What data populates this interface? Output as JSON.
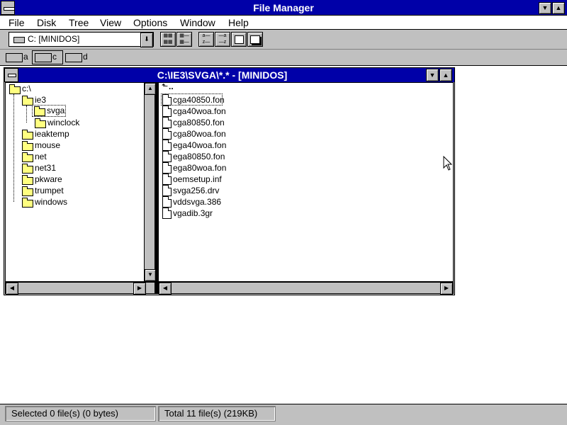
{
  "window": {
    "title": "File Manager"
  },
  "menu": [
    {
      "label": "File"
    },
    {
      "label": "Disk"
    },
    {
      "label": "Tree"
    },
    {
      "label": "View"
    },
    {
      "label": "Options"
    },
    {
      "label": "Window"
    },
    {
      "label": "Help"
    }
  ],
  "toolbar": {
    "drive_combo_value": "C: [MINIDOS]"
  },
  "drives": [
    {
      "label": "a"
    },
    {
      "label": "c"
    },
    {
      "label": "d"
    }
  ],
  "child_window": {
    "title": "C:\\IE3\\SVGA\\*.* - [MINIDOS]"
  },
  "tree": [
    {
      "label": "c:\\"
    },
    {
      "label": "ie3"
    },
    {
      "label": "svga"
    },
    {
      "label": "winclock"
    },
    {
      "label": "ieaktemp"
    },
    {
      "label": "mouse"
    },
    {
      "label": "net"
    },
    {
      "label": "net31"
    },
    {
      "label": "pkware"
    },
    {
      "label": "trumpet"
    },
    {
      "label": "windows"
    }
  ],
  "files": {
    "up_label": "..",
    "items": [
      {
        "name": "cga40850.fon"
      },
      {
        "name": "cga40woa.fon"
      },
      {
        "name": "cga80850.fon"
      },
      {
        "name": "cga80woa.fon"
      },
      {
        "name": "ega40woa.fon"
      },
      {
        "name": "ega80850.fon"
      },
      {
        "name": "ega80woa.fon"
      },
      {
        "name": "oemsetup.inf"
      },
      {
        "name": "svga256.drv"
      },
      {
        "name": "vddsvga.386"
      },
      {
        "name": "vgadib.3gr"
      }
    ]
  },
  "status": {
    "selected": "Selected 0 file(s) (0 bytes)",
    "total": "Total 11 file(s) (219KB)"
  },
  "colors": {
    "titlebar": "#0000a8",
    "face": "#c0c0c0",
    "folder": "#ffff80"
  }
}
